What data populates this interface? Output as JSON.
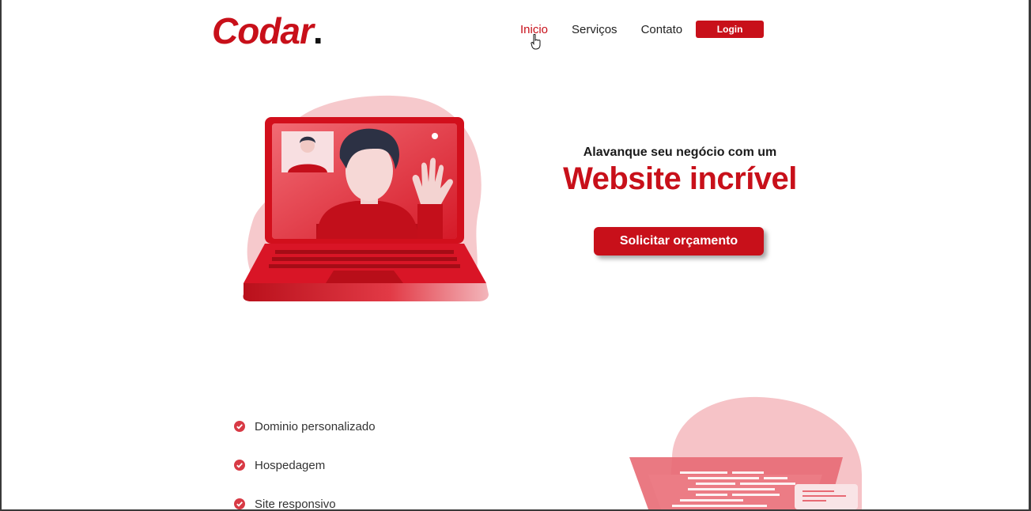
{
  "brand": {
    "name": "Codar",
    "dot": ".",
    "accent": "#c8101a"
  },
  "nav": {
    "items": [
      {
        "label": "Inicio",
        "active": true
      },
      {
        "label": "Serviços",
        "active": false
      },
      {
        "label": "Contato",
        "active": false
      }
    ],
    "login_label": "Login"
  },
  "hero": {
    "subtitle": "Alavanque seu negócio com um",
    "title": "Website incrível",
    "cta_label": "Solicitar orçamento"
  },
  "features": [
    {
      "label": "Dominio personalizado",
      "icon": "check-circle-icon"
    },
    {
      "label": "Hospedagem",
      "icon": "check-circle-icon"
    },
    {
      "label": "Site responsivo",
      "icon": "check-circle-icon"
    }
  ]
}
